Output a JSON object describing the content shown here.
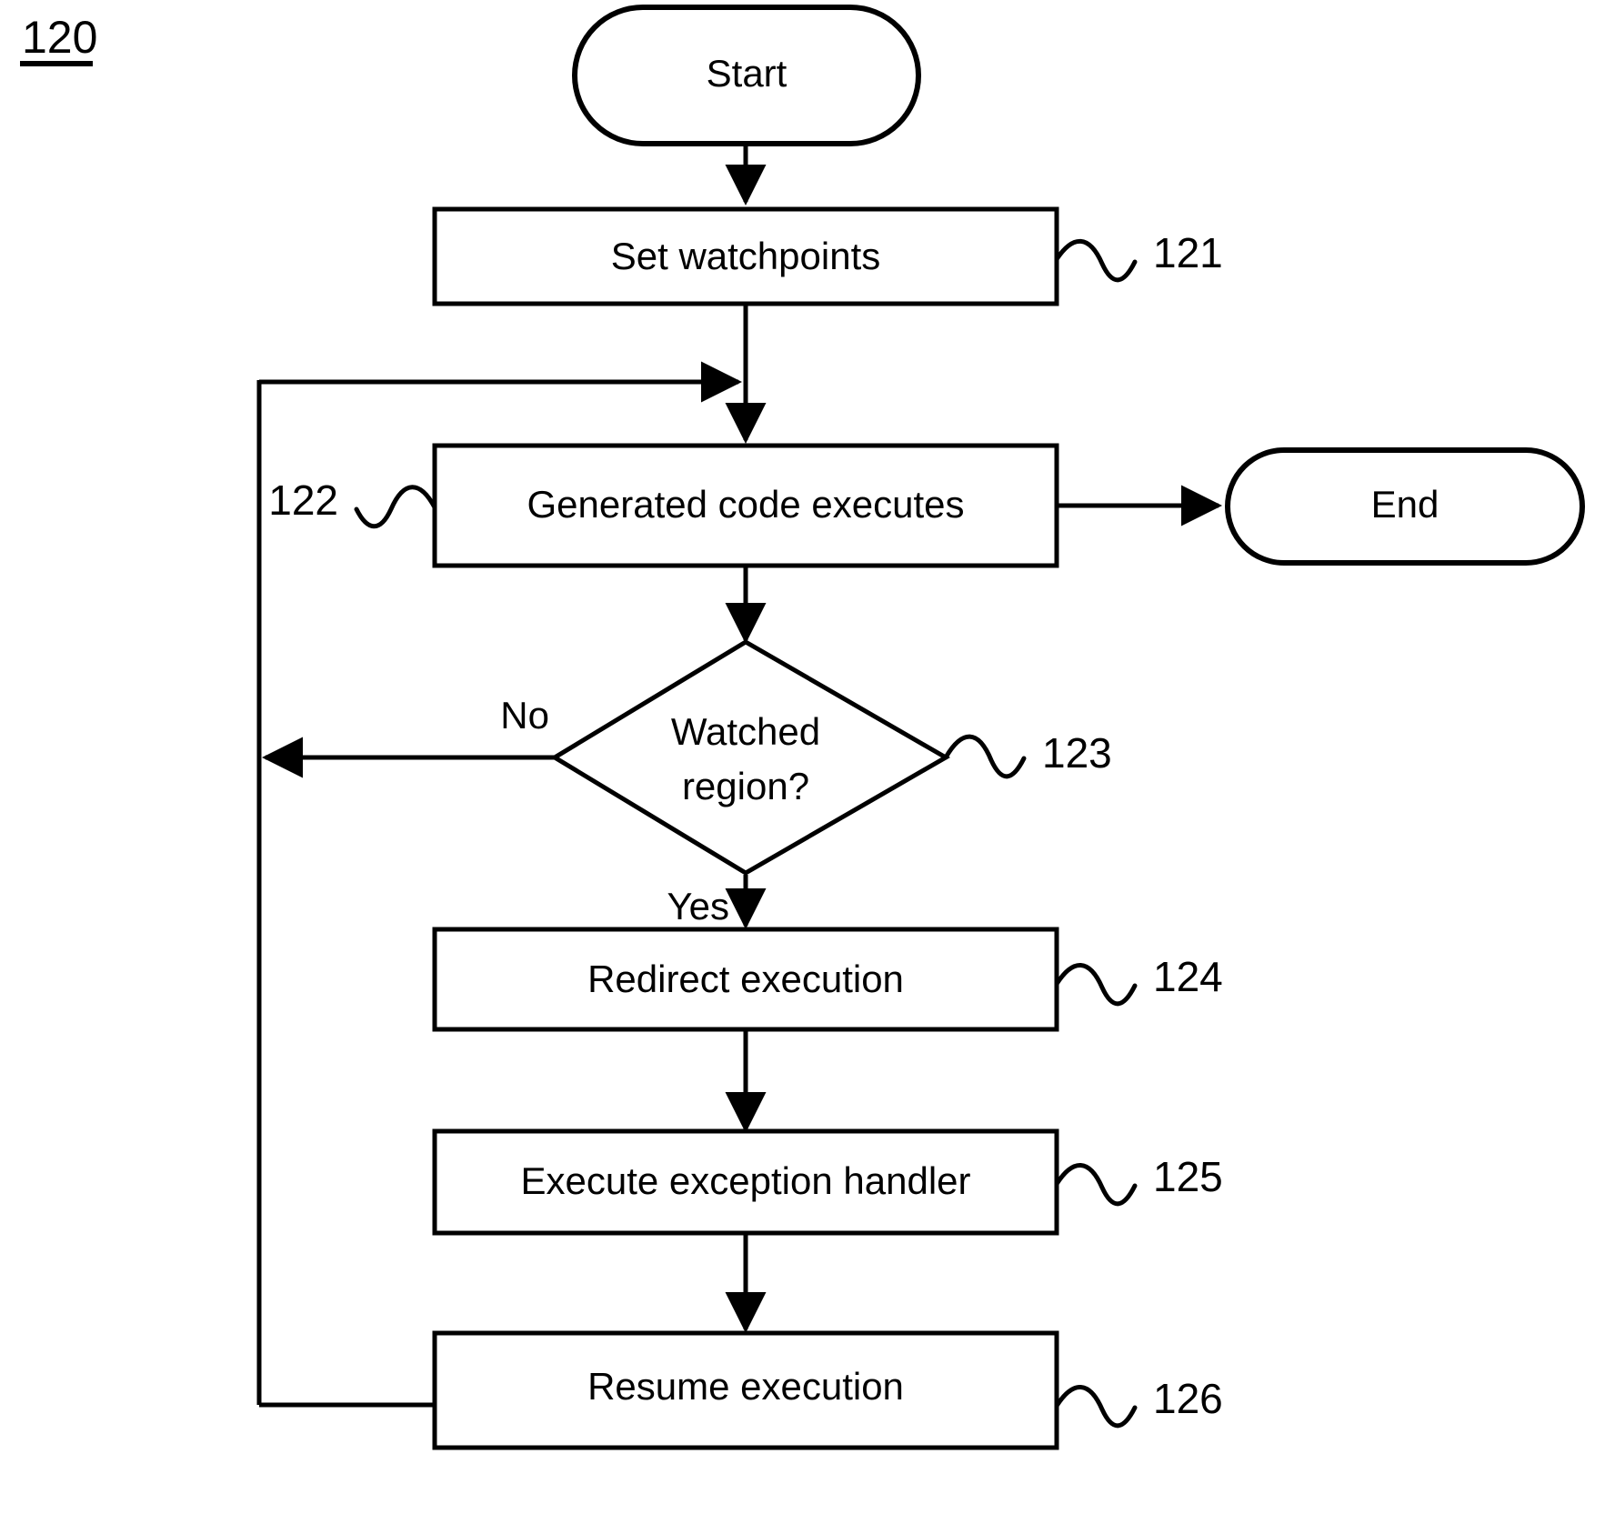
{
  "figure": {
    "number": "120",
    "underlined": true
  },
  "diagram": {
    "type": "flowchart",
    "orientation": "top-to-bottom",
    "background_color": "#ffffff",
    "line_color": "#000000",
    "nodes": [
      {
        "id": "start",
        "shape": "terminator",
        "label": "Start",
        "ref": null
      },
      {
        "id": "n121",
        "shape": "process",
        "label": "Set watchpoints",
        "ref": "121"
      },
      {
        "id": "n122",
        "shape": "process",
        "label": "Generated code executes",
        "ref": "122"
      },
      {
        "id": "end",
        "shape": "terminator",
        "label": "End",
        "ref": null
      },
      {
        "id": "n123",
        "shape": "decision",
        "label": "Watched region?",
        "ref": "123"
      },
      {
        "id": "n124",
        "shape": "process",
        "label": "Redirect execution",
        "ref": "124"
      },
      {
        "id": "n125",
        "shape": "process",
        "label": "Execute exception handler",
        "ref": "125"
      },
      {
        "id": "n126",
        "shape": "process",
        "label": "Resume execution",
        "ref": "126"
      }
    ],
    "decision_label_lines": {
      "line1": "Watched",
      "line2": "region?"
    },
    "edges": [
      {
        "from": "start",
        "to": "n121",
        "label": "",
        "arrow": true
      },
      {
        "from": "n121",
        "to": "n122",
        "label": "",
        "arrow": true
      },
      {
        "from": "n122",
        "to": "end",
        "label": "",
        "arrow": true
      },
      {
        "from": "n122",
        "to": "n123",
        "label": "",
        "arrow": true
      },
      {
        "from": "n123",
        "to": "n122",
        "label": "No",
        "arrow": true
      },
      {
        "from": "n123",
        "to": "n124",
        "label": "Yes",
        "arrow": true
      },
      {
        "from": "n124",
        "to": "n125",
        "label": "",
        "arrow": true
      },
      {
        "from": "n125",
        "to": "n126",
        "label": "",
        "arrow": true
      },
      {
        "from": "n126",
        "to": "n122",
        "label": "",
        "arrow": true
      }
    ],
    "edge_labels": {
      "no": "No",
      "yes": "Yes"
    },
    "reference_numerals": {
      "n121": "121",
      "n122": "122",
      "n123": "123",
      "n124": "124",
      "n125": "125",
      "n126": "126"
    }
  }
}
